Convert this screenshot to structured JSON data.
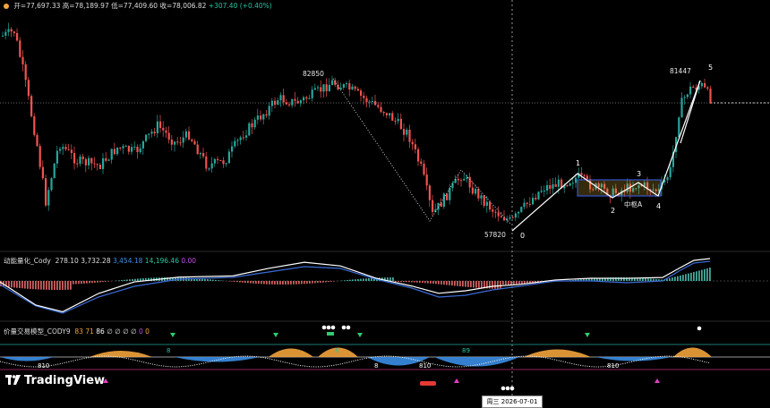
{
  "header": {
    "open_label": "开=",
    "open": "77,697.33",
    "high_label": "高=",
    "high": "78,189.97",
    "low_label": "低=",
    "low": "77,409.60",
    "close_label": "收=",
    "close": "78,006.82",
    "change": "+307.40 (+0.40%)"
  },
  "main_chart": {
    "peak_label": "82850",
    "low_label": "57820",
    "recent_high_label": "81447",
    "wave_labels": [
      "0",
      "1",
      "2",
      "3",
      "4",
      "5"
    ],
    "zone_label": "中枢A"
  },
  "macd_panel": {
    "name": "动能量化_Cody",
    "v1": "278.10",
    "v2": "3,732.28",
    "v3": "3,454.18",
    "v4": "14,196.46",
    "v5": "0.00"
  },
  "model_panel": {
    "name": "价量交易模型_CODY9",
    "v1": "83",
    "v2": "71",
    "v3": "86",
    "empties": [
      "∅",
      "∅",
      "∅",
      "∅"
    ],
    "v4": "0",
    "v5": "0",
    "marks": [
      "8",
      "8",
      "89",
      "8",
      "8",
      "8",
      "89",
      "8"
    ],
    "mark_pairs": [
      "8",
      "10",
      "8",
      "10",
      "8",
      "10"
    ]
  },
  "crosshair": {
    "date_label": "周三 2026-07-01"
  },
  "branding": {
    "logo_text": "TradingView"
  },
  "colors": {
    "up": "#26a69a",
    "down": "#ef5350",
    "orange": "#f2a33a",
    "blue": "#3a8ee6",
    "zone": "#3355cc"
  }
}
